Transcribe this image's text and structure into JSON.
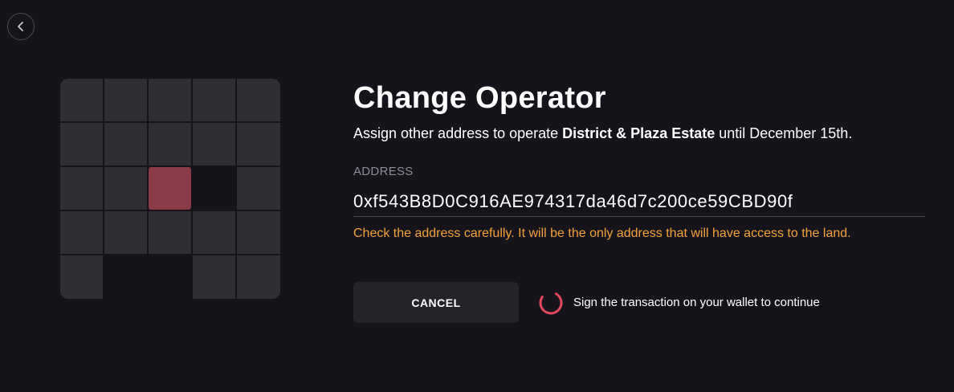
{
  "back_button": {
    "icon": "chevron-left-icon"
  },
  "map": {
    "selected_color": "#8b3a47",
    "parcel_color": "#2f2e35"
  },
  "header": {
    "title": "Change Operator",
    "subtitle_prefix": "Assign other address to operate ",
    "estate_name": "District & Plaza Estate",
    "subtitle_suffix": " until December 15th."
  },
  "address_field": {
    "label": "ADDRESS",
    "value": "0xf543B8D0C916AE974317da46d7c200ce59CBD90f"
  },
  "warning": "Check the address carefully. It will be the only address that will have access to the land.",
  "actions": {
    "cancel_label": "CANCEL",
    "loading_text": "Sign the transaction on your wallet to continue"
  },
  "colors": {
    "background": "#16141a",
    "warning": "#f3a23a",
    "spinner": "#e2475c"
  }
}
